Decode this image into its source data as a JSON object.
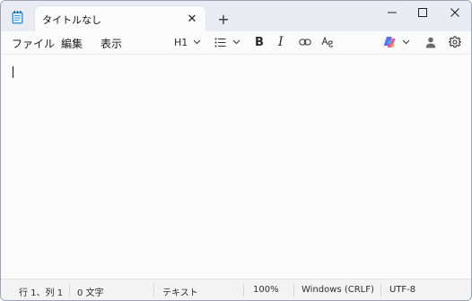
{
  "tab": {
    "title": "タイトルなし",
    "close_glyph": "✕"
  },
  "new_tab_glyph": "+",
  "menu": {
    "file": "ファイル",
    "edit": "編集",
    "view": "表示"
  },
  "toolbar": {
    "heading": "H1",
    "bold": "B",
    "italic": "I"
  },
  "status": {
    "position": "行 1、列 1",
    "chars": "0 文字",
    "format": "テキスト",
    "zoom": "100%",
    "line_ending": "Windows (CRLF)",
    "encoding": "UTF-8"
  },
  "colors": {
    "titlebar": "#e9edf3",
    "editor_bg": "#fbfbfb",
    "notepad_icon": "#3b9be0"
  },
  "icons": [
    "notepad-app-icon",
    "close-icon",
    "plus-icon",
    "minimize-icon",
    "maximize-icon",
    "window-close-icon",
    "chevron-down-icon",
    "list-icon",
    "link-icon",
    "spellcheck-icon",
    "copilot-icon",
    "account-icon",
    "gear-icon"
  ]
}
